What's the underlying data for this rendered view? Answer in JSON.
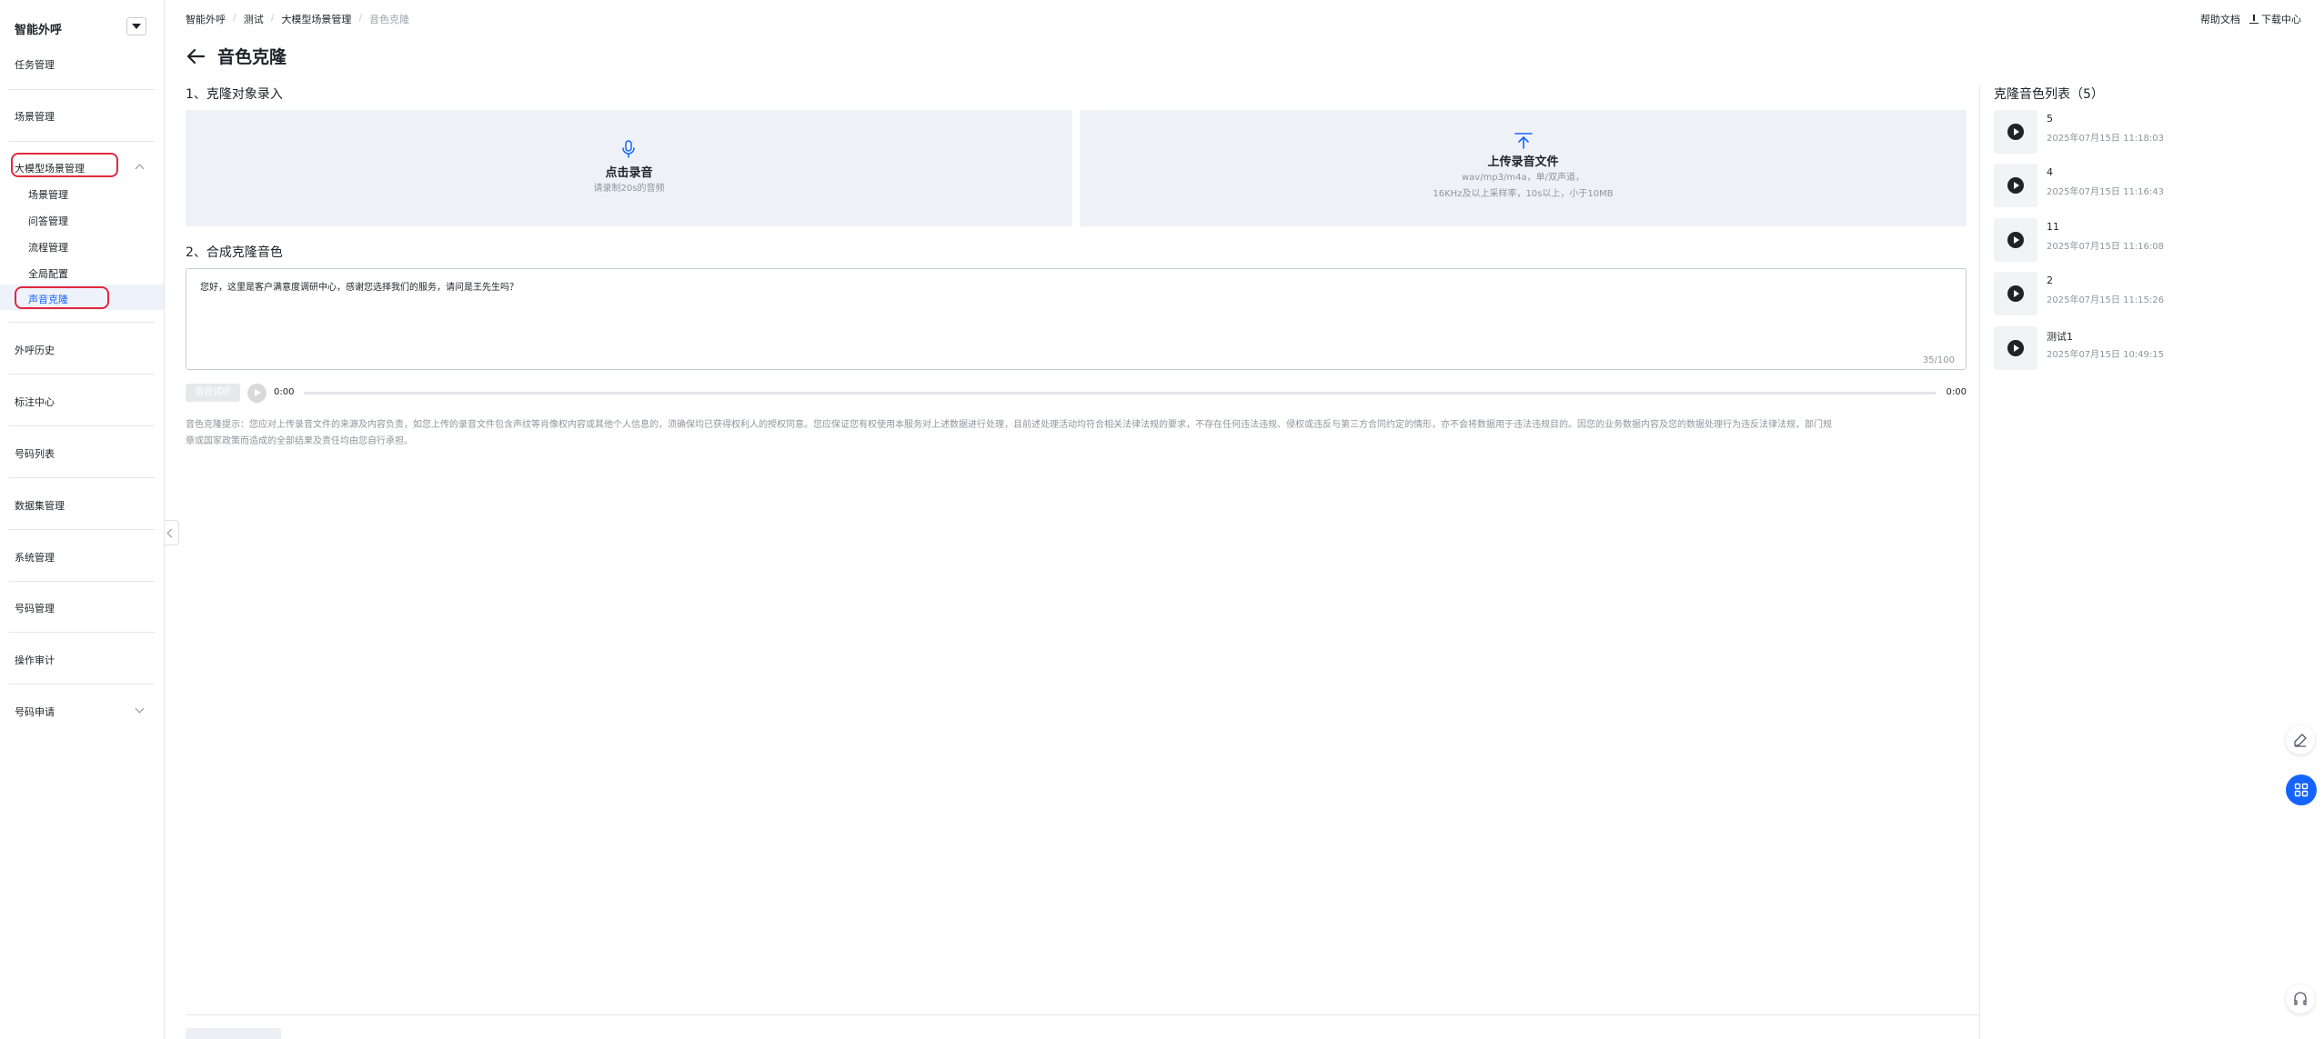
{
  "sidebar": {
    "brand": "智能外呼",
    "items": {
      "task": "任务管理",
      "scene": "场景管理",
      "llm_scene": "大模型场景管理",
      "sub_scene": "场景管理",
      "sub_qa": "问答管理",
      "sub_flow": "流程管理",
      "sub_global": "全局配置",
      "sub_voice": "声音克隆",
      "history": "外呼历史",
      "annotation": "标注中心",
      "numbers": "号码列表",
      "dataset": "数据集管理",
      "system": "系统管理",
      "number_mgmt": "号码管理",
      "audit": "操作审计",
      "number_apply": "号码申请"
    }
  },
  "header": {
    "breadcrumb": [
      "智能外呼",
      "测试",
      "大模型场景管理",
      "音色克隆"
    ],
    "help_doc": "帮助文档",
    "download_center": "下载中心"
  },
  "page": {
    "title": "音色克隆",
    "section1": "1、克隆对象录入",
    "record": {
      "label": "点击录音",
      "hint": "请录制20s的音频"
    },
    "upload": {
      "label": "上传录音文件",
      "hint1": "wav/mp3/m4a，单/双声道，",
      "hint2": "16KHz及以上采样率，10s以上，小于10MB"
    },
    "section2": "2、合成克隆音色",
    "text_value": "您好，这里是客户满意度调研中心，感谢您选择我们的服务，请问是王先生吗？",
    "char_count": "35/100",
    "synth_button": "语音试听",
    "time_current": "0:00",
    "time_total": "0:00",
    "disclaimer_line1": "音色克隆提示：您应对上传录音文件的来源及内容负责，如您上传的录音文件包含声纹等肖像权内容或其他个人信息的，须确保均已获得权利人的授权同意。您应保证您有权使用本服务对上述数据进行处理，且前述处理活动均符合相关法律法规的要求，不存在任何违法违规、侵权或违反与第三方合同约定的情形，亦不会将数据用于违法违规目的。因您的业务数据内容及您的数据处理行为违反法律法规，部门规",
    "disclaimer_line2": "章或国家政策而造成的全部结果及责任均由您自行承担。"
  },
  "voice_list": {
    "title": "克隆音色列表（5）",
    "items": [
      {
        "name": "5",
        "time": "2025年07月15日 11:18:03"
      },
      {
        "name": "4",
        "time": "2025年07月15日 11:16:43"
      },
      {
        "name": "11",
        "time": "2025年07月15日 11:16:08"
      },
      {
        "name": "2",
        "time": "2025年07月15日 11:15:26"
      },
      {
        "name": "测试1",
        "time": "2025年07月15日 10:49:15"
      }
    ]
  },
  "colors": {
    "accent": "#1664ff",
    "highlight_box": "#e0283f",
    "card_bg": "#eef2f7"
  }
}
